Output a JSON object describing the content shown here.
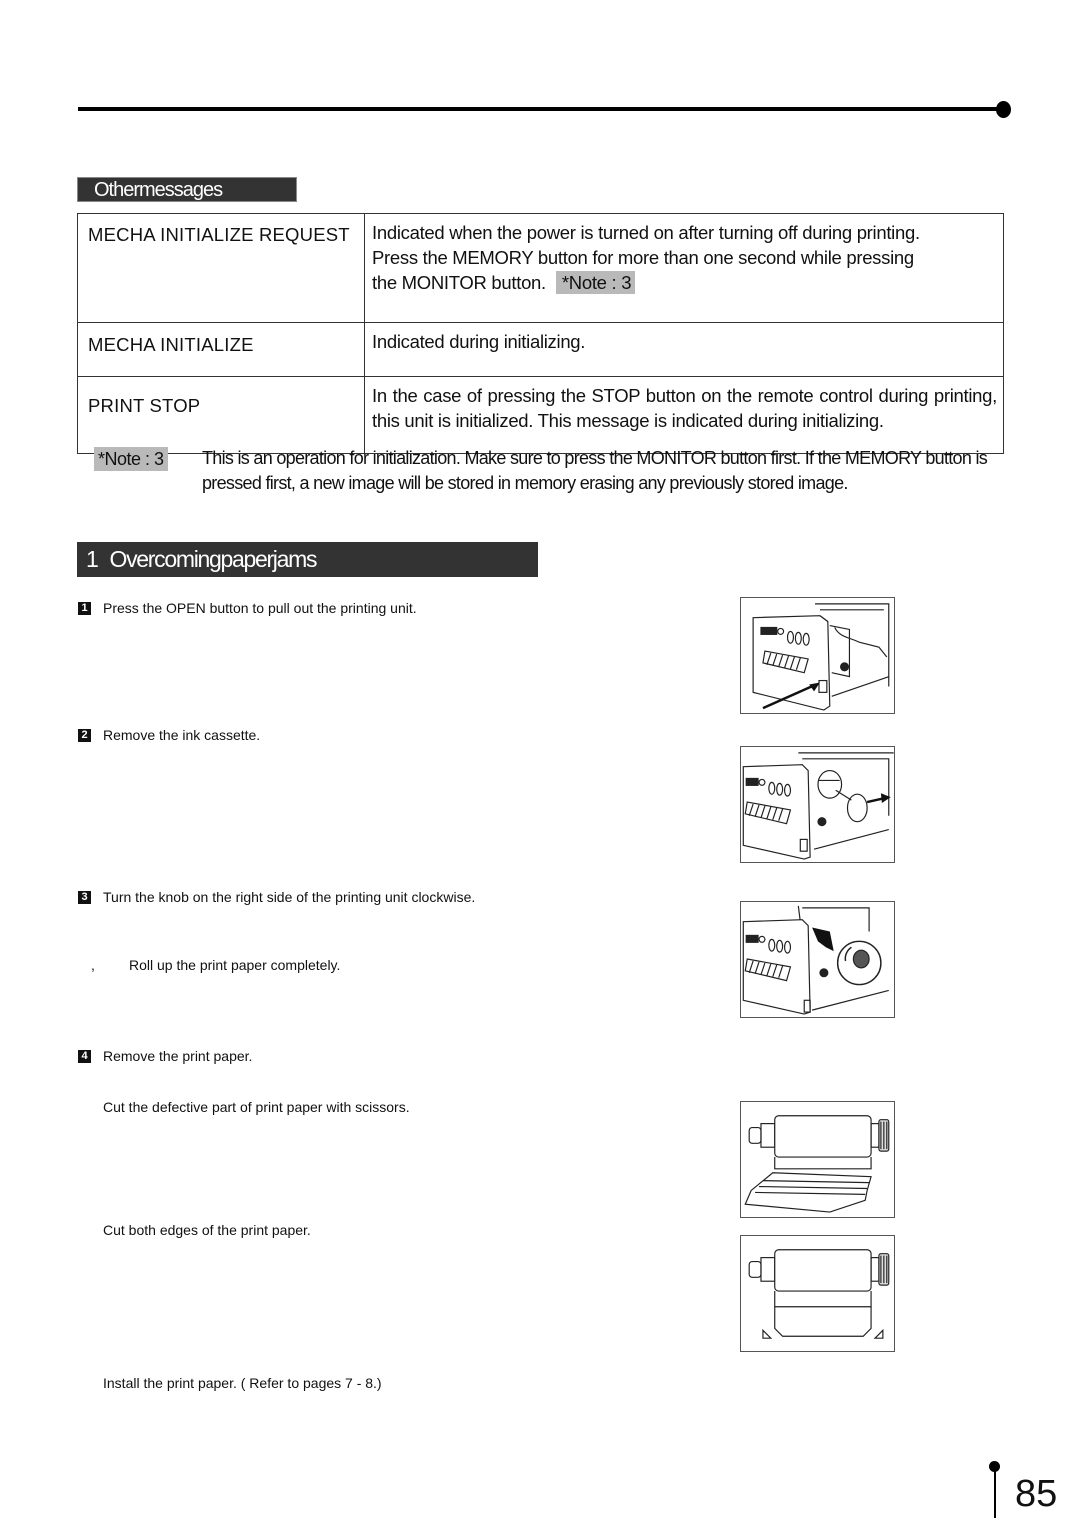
{
  "section": {
    "label": "Othermessages"
  },
  "messages_table": {
    "rows": [
      {
        "message": "MECHA INITIALIZE REQUEST",
        "description_lines": [
          "Indicated when the power is turned on after turning off during printing.",
          "Press the MEMORY button for more than one second while pressing",
          "the MONITOR button."
        ],
        "note_ref": "*Note : 3"
      },
      {
        "message": "MECHA  INITIALIZE",
        "description": "Indicated during initializing."
      },
      {
        "message": "PRINT  STOP",
        "description": "In the case of pressing the STOP button on the remote control during printing, this unit is initialized. This message is indicated during initializing."
      }
    ]
  },
  "note": {
    "tag": "*Note : 3",
    "text": "This is an operation for initialization. Make sure to press the MONITOR button first. If the MEMORY button is pressed first, a new image will be stored in memory erasing any previously stored image."
  },
  "heading": {
    "number": "1",
    "title": "Overcomingpaperjams"
  },
  "steps": [
    {
      "badge": "1",
      "text": "Press the OPEN button to pull out the printing unit."
    },
    {
      "badge": "2",
      "text": "Remove the ink cassette."
    },
    {
      "badge": "3",
      "text": "Turn the knob on the right side of the printing unit clockwise."
    },
    {
      "badge": "4",
      "text": "Remove the print paper."
    }
  ],
  "substeps": {
    "roll_up_prefix": ",",
    "roll_up": "Roll up the print paper completely.",
    "cut_defective": "Cut the defective part of print paper with scissors.",
    "cut_edges": "Cut both edges of the print paper.",
    "install": "Install the print paper. ( Refer to pages 7 - 8.)"
  },
  "figures": [
    {
      "name": "open-button-illustration",
      "icon": "printer-open-button-arrow"
    },
    {
      "name": "remove-cassette-illustration",
      "icon": "printer-cassette-out-arrow"
    },
    {
      "name": "turn-knob-illustration",
      "icon": "printer-knob-zoom"
    },
    {
      "name": "cut-defective-paper-illustration",
      "icon": "paper-roll-torn"
    },
    {
      "name": "cut-edges-illustration",
      "icon": "paper-roll-cut-corners"
    }
  ],
  "page_number": "85"
}
